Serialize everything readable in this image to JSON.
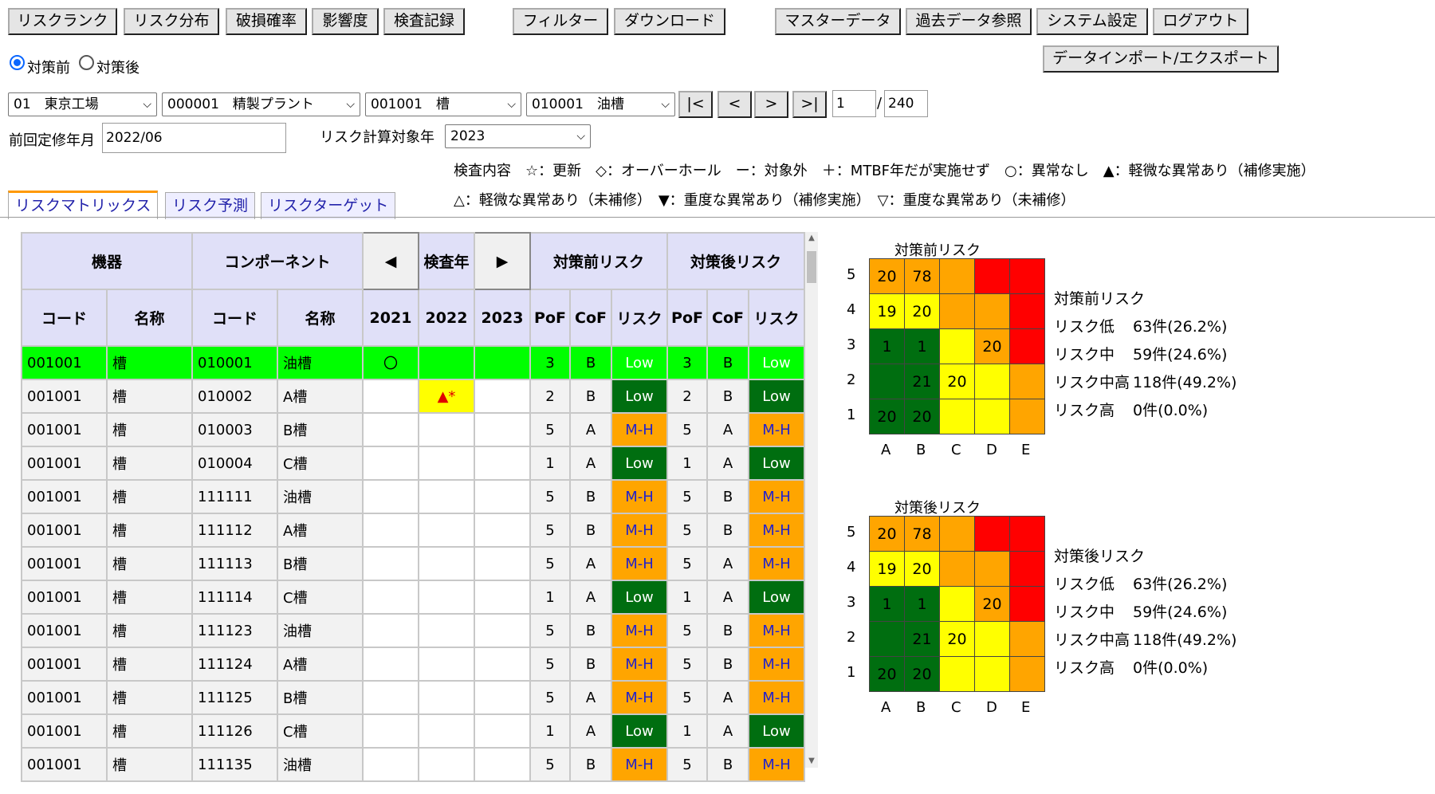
{
  "toolbar": {
    "risk_rank": "リスクランク",
    "risk_dist": "リスク分布",
    "break_prob": "破損確率",
    "impact": "影響度",
    "inspection": "検査記録",
    "filter": "フィルター",
    "download": "ダウンロード",
    "master": "マスターデータ",
    "history": "過去データ参照",
    "system": "システム設定",
    "logout": "ログアウト",
    "import_export": "データインポート/エクスポート"
  },
  "mode": {
    "before": "対策前",
    "after": "対策後",
    "selected": "before"
  },
  "selectors": {
    "factory": "01　東京工場",
    "plant": "000001　精製プラント",
    "equipment": "001001　槽",
    "component": "010001　油槽"
  },
  "pager": {
    "first": "|<",
    "prev": "<",
    "next": ">",
    "last": ">|",
    "page": "1",
    "separator": "/",
    "total": "240"
  },
  "last_revision": {
    "label": "前回定修年月",
    "value": "2022/06"
  },
  "calc_year": {
    "label": "リスク計算対象年",
    "value": "2023"
  },
  "legend": {
    "line1": "検査内容　☆：更新　◇：オーバーホール　ー：対象外　＋：MTBF年だが実施せず　○：異常なし　▲：軽微な異常あり（補修実施）",
    "line2": "△：軽微な異常あり（未補修）　▼：重度な異常あり（補修実施）　▽：重度な異常あり（未補修）"
  },
  "tabs": [
    "リスクマトリックス",
    "リスク予測",
    "リスクターゲット"
  ],
  "table": {
    "group_headers": {
      "equipment": "機器",
      "component": "コンポーネント",
      "prev": "◀",
      "year": "検査年",
      "next": "▶",
      "before": "対策前リスク",
      "after": "対策後リスク"
    },
    "sub_headers": {
      "code": "コード",
      "name": "名称",
      "code2": "コード",
      "name2": "名称",
      "y1": "2021",
      "y2": "2022",
      "y3": "2023",
      "pof": "PoF",
      "cof": "CoF",
      "risk": "リスク",
      "pof2": "PoF",
      "cof2": "CoF",
      "risk2": "リスク"
    },
    "rows": [
      [
        "001001",
        "槽",
        "010001",
        "油槽",
        "〇",
        "",
        "",
        "3",
        "B",
        "Low",
        "3",
        "B",
        "Low"
      ],
      [
        "001001",
        "槽",
        "010002",
        "A槽",
        "",
        "▲*",
        "",
        "2",
        "B",
        "Low",
        "2",
        "B",
        "Low"
      ],
      [
        "001001",
        "槽",
        "010003",
        "B槽",
        "",
        "",
        "",
        "5",
        "A",
        "M-H",
        "5",
        "A",
        "M-H"
      ],
      [
        "001001",
        "槽",
        "010004",
        "C槽",
        "",
        "",
        "",
        "1",
        "A",
        "Low",
        "1",
        "A",
        "Low"
      ],
      [
        "001001",
        "槽",
        "111111",
        "油槽",
        "",
        "",
        "",
        "5",
        "B",
        "M-H",
        "5",
        "B",
        "M-H"
      ],
      [
        "001001",
        "槽",
        "111112",
        "A槽",
        "",
        "",
        "",
        "5",
        "B",
        "M-H",
        "5",
        "B",
        "M-H"
      ],
      [
        "001001",
        "槽",
        "111113",
        "B槽",
        "",
        "",
        "",
        "5",
        "A",
        "M-H",
        "5",
        "A",
        "M-H"
      ],
      [
        "001001",
        "槽",
        "111114",
        "C槽",
        "",
        "",
        "",
        "1",
        "A",
        "Low",
        "1",
        "A",
        "Low"
      ],
      [
        "001001",
        "槽",
        "111123",
        "油槽",
        "",
        "",
        "",
        "5",
        "B",
        "M-H",
        "5",
        "B",
        "M-H"
      ],
      [
        "001001",
        "槽",
        "111124",
        "A槽",
        "",
        "",
        "",
        "5",
        "B",
        "M-H",
        "5",
        "B",
        "M-H"
      ],
      [
        "001001",
        "槽",
        "111125",
        "B槽",
        "",
        "",
        "",
        "5",
        "A",
        "M-H",
        "5",
        "A",
        "M-H"
      ],
      [
        "001001",
        "槽",
        "111126",
        "C槽",
        "",
        "",
        "",
        "1",
        "A",
        "Low",
        "1",
        "A",
        "Low"
      ],
      [
        "001001",
        "槽",
        "111135",
        "油槽",
        "",
        "",
        "",
        "5",
        "B",
        "M-H",
        "5",
        "B",
        "M-H"
      ]
    ]
  },
  "matrices": [
    {
      "title": "対策前リスク",
      "rows": [
        "5",
        "4",
        "3",
        "2",
        "1"
      ],
      "cols": [
        "A",
        "B",
        "C",
        "D",
        "E"
      ],
      "values": [
        [
          "20",
          "78",
          "",
          "",
          ""
        ],
        [
          "19",
          "20",
          "",
          "",
          ""
        ],
        [
          "1",
          "1",
          "",
          "20",
          ""
        ],
        [
          "",
          "21",
          "20",
          "",
          ""
        ],
        [
          "20",
          "20",
          "",
          "",
          ""
        ]
      ],
      "colors": [
        [
          "#ffa500",
          "#ffa500",
          "#ffa500",
          "#ff0000",
          "#ff0000"
        ],
        [
          "#ffff00",
          "#ffff00",
          "#ffa500",
          "#ffa500",
          "#ff0000"
        ],
        [
          "#006e10",
          "#006e10",
          "#ffff00",
          "#ffa500",
          "#ff0000"
        ],
        [
          "#006e10",
          "#006e10",
          "#ffff00",
          "#ffff00",
          "#ffa500"
        ],
        [
          "#006e10",
          "#006e10",
          "#ffff00",
          "#ffff00",
          "#ffa500"
        ]
      ],
      "stats_title": "対策前リスク",
      "stats": [
        {
          "label": "リスク低",
          "value": "63件(26.2%)"
        },
        {
          "label": "リスク中",
          "value": "59件(24.6%)"
        },
        {
          "label": "リスク中高",
          "value": "118件(49.2%)"
        },
        {
          "label": "リスク高",
          "value": "0件(0.0%)"
        }
      ]
    },
    {
      "title": "対策後リスク",
      "rows": [
        "5",
        "4",
        "3",
        "2",
        "1"
      ],
      "cols": [
        "A",
        "B",
        "C",
        "D",
        "E"
      ],
      "values": [
        [
          "20",
          "78",
          "",
          "",
          ""
        ],
        [
          "19",
          "20",
          "",
          "",
          ""
        ],
        [
          "1",
          "1",
          "",
          "20",
          ""
        ],
        [
          "",
          "21",
          "20",
          "",
          ""
        ],
        [
          "20",
          "20",
          "",
          "",
          ""
        ]
      ],
      "colors": [
        [
          "#ffa500",
          "#ffa500",
          "#ffa500",
          "#ff0000",
          "#ff0000"
        ],
        [
          "#ffff00",
          "#ffff00",
          "#ffa500",
          "#ffa500",
          "#ff0000"
        ],
        [
          "#006e10",
          "#006e10",
          "#ffff00",
          "#ffa500",
          "#ff0000"
        ],
        [
          "#006e10",
          "#006e10",
          "#ffff00",
          "#ffff00",
          "#ffa500"
        ],
        [
          "#006e10",
          "#006e10",
          "#ffff00",
          "#ffff00",
          "#ffa500"
        ]
      ],
      "stats_title": "対策後リスク",
      "stats": [
        {
          "label": "リスク低",
          "value": "63件(26.2%)"
        },
        {
          "label": "リスク中",
          "value": "59件(24.6%)"
        },
        {
          "label": "リスク中高",
          "value": "118件(49.2%)"
        },
        {
          "label": "リスク高",
          "value": "0件(0.0%)"
        }
      ]
    }
  ]
}
